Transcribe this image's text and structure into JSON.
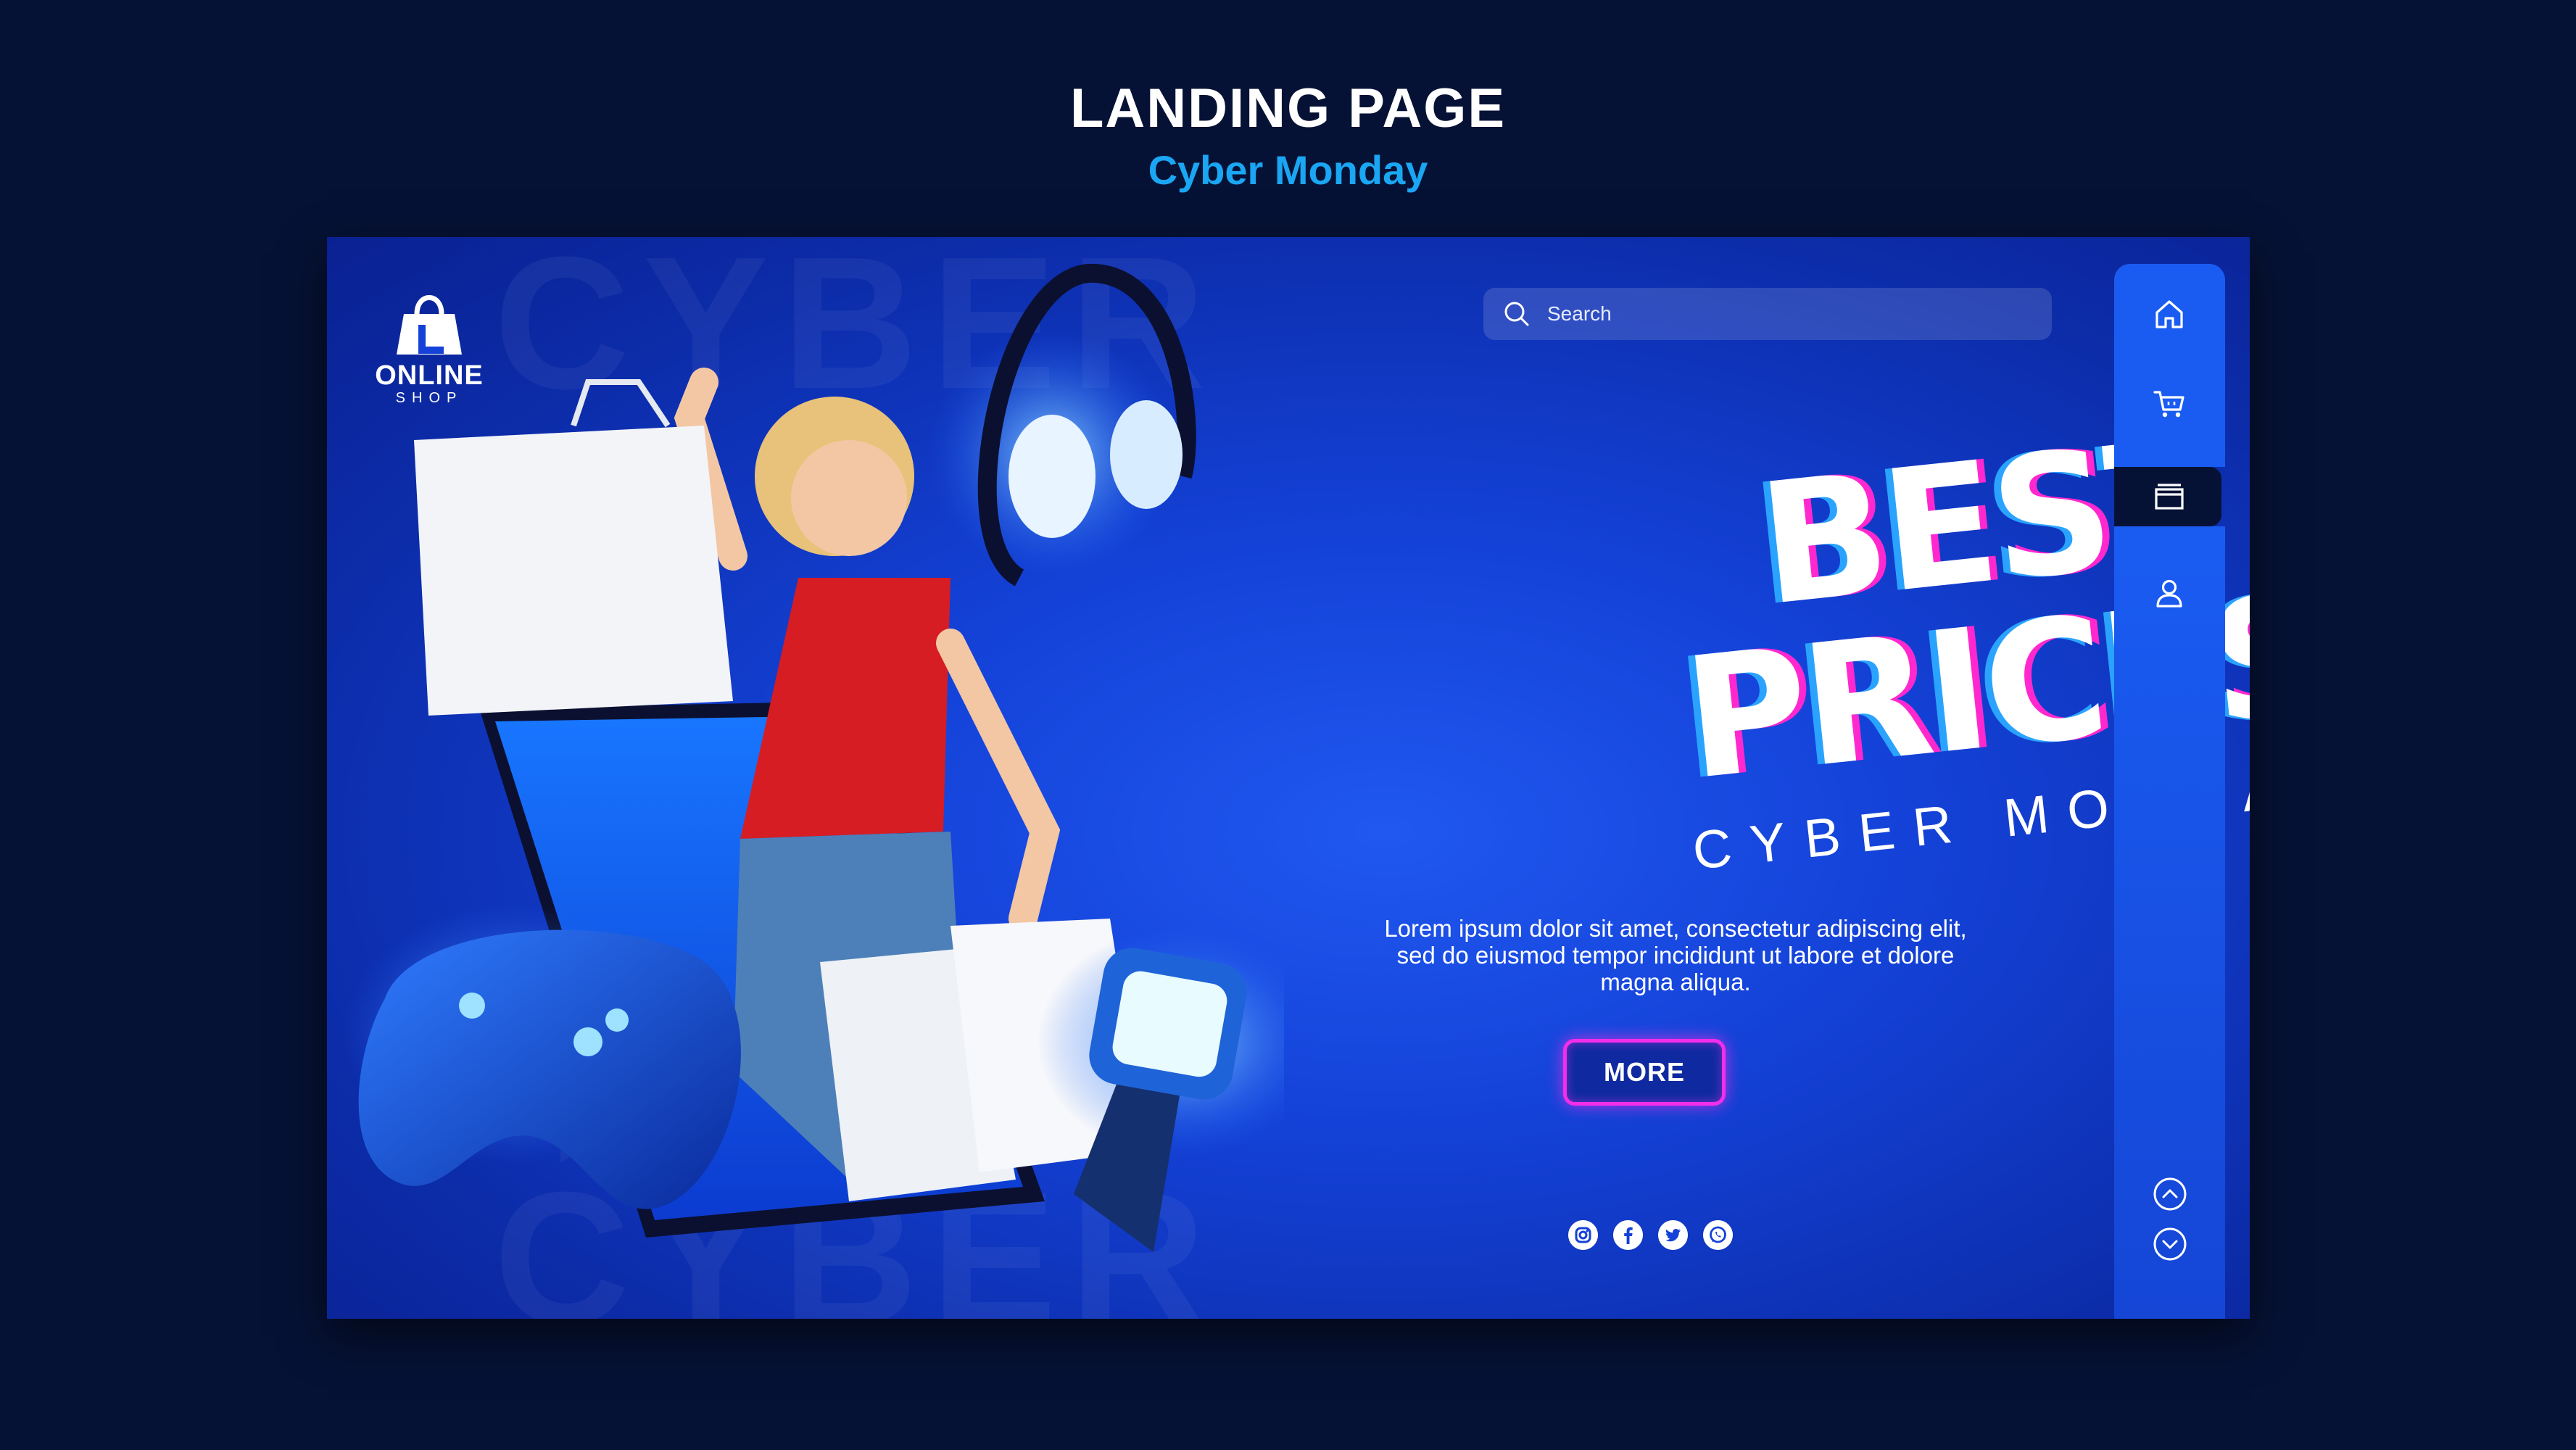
{
  "header": {
    "title": "LANDING PAGE",
    "subtitle": "Cyber Monday"
  },
  "card": {
    "background_word": "CYBER",
    "logo": {
      "line1": "ONLINE",
      "line2": "SHOP"
    },
    "search": {
      "placeholder": "Search"
    },
    "headline": {
      "line1": "BEST",
      "line2": "PRICES",
      "tagline": "CYBER MONDAY"
    },
    "body_text": "Lorem ipsum dolor sit amet, consectetur adipiscing elit, sed do eiusmod tempor incididunt ut labore et dolore magna aliqua.",
    "cta": {
      "label": "MORE"
    },
    "socials": [
      {
        "icon": "instagram-icon"
      },
      {
        "icon": "facebook-icon"
      },
      {
        "icon": "twitter-icon"
      },
      {
        "icon": "whatsapp-icon"
      }
    ],
    "sidebar": {
      "items": [
        {
          "icon": "home-icon"
        },
        {
          "icon": "cart-icon"
        },
        {
          "icon": "window-icon",
          "active": true
        },
        {
          "icon": "user-icon"
        }
      ],
      "scroll": [
        {
          "icon": "chevron-up-icon"
        },
        {
          "icon": "chevron-down-icon"
        }
      ]
    }
  },
  "colors": {
    "page_background": "#061235",
    "accent_blue": "#1aa6f3",
    "card_blue": "#1442d8",
    "glitch_cyan": "#2aa3ff",
    "glitch_magenta": "#ff28cf",
    "button_border": "#f22eea",
    "sidebar_blue": "#1a5cf2"
  }
}
